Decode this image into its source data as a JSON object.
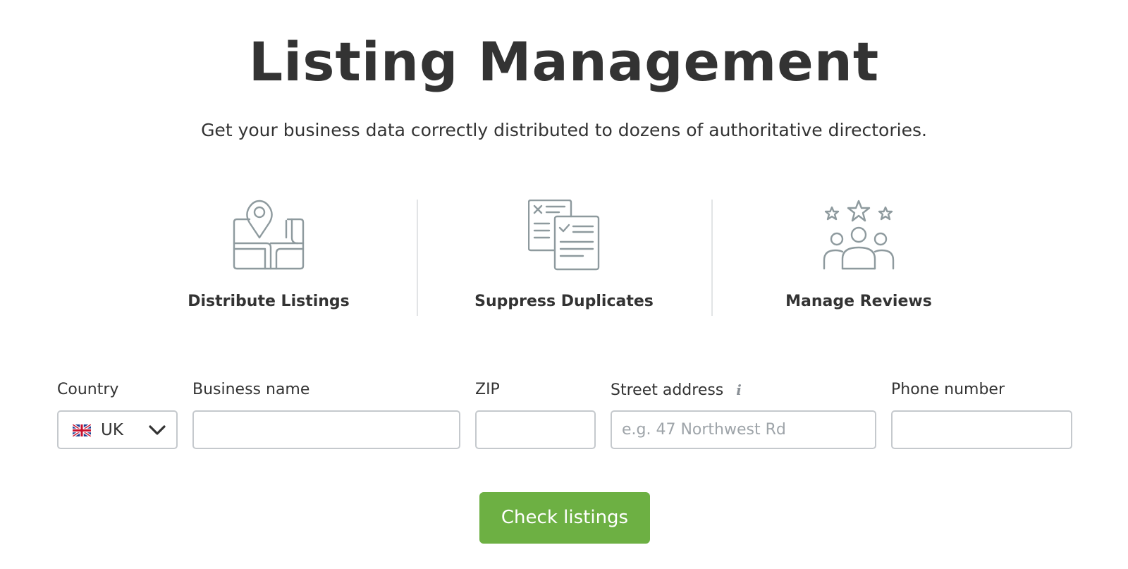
{
  "header": {
    "title": "Listing Management",
    "subtitle": "Get your business data correctly distributed to dozens of authoritative directories."
  },
  "features": [
    {
      "label": "Distribute Listings",
      "icon": "map-pin-icon"
    },
    {
      "label": "Suppress Duplicates",
      "icon": "documents-check-icon"
    },
    {
      "label": "Manage Reviews",
      "icon": "people-stars-icon"
    }
  ],
  "form": {
    "country": {
      "label": "Country",
      "value": "UK",
      "flag_icon": "uk-flag-icon"
    },
    "business_name": {
      "label": "Business name",
      "value": "",
      "placeholder": ""
    },
    "zip": {
      "label": "ZIP",
      "value": "",
      "placeholder": ""
    },
    "street_address": {
      "label": "Street address",
      "info_icon": "i",
      "value": "",
      "placeholder": "e.g. 47 Northwest Rd"
    },
    "phone_number": {
      "label": "Phone number",
      "value": "",
      "placeholder": ""
    }
  },
  "submit": {
    "label": "Check listings"
  },
  "colors": {
    "button": "#6db043",
    "icon_stroke": "#8e9a9e",
    "input_border": "#c5c9cd",
    "text": "#333333"
  }
}
